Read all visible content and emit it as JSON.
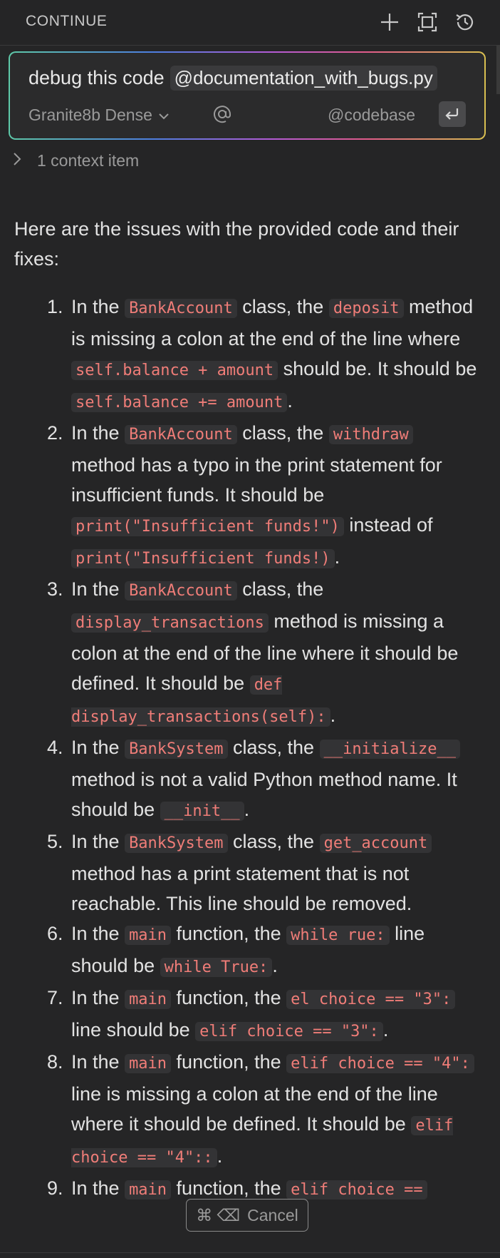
{
  "header": {
    "title": "CONTINUE"
  },
  "input": {
    "text": "debug this code",
    "mention": "@documentation_with_bugs.py",
    "model": "Granite8b Dense",
    "at_symbol": "@",
    "codebase": "@codebase"
  },
  "context": {
    "label": "1 context item"
  },
  "response": {
    "intro": "Here are the issues with the provided code and their fixes:",
    "items": [
      {
        "num": "1.",
        "parts": [
          {
            "t": "In the "
          },
          {
            "c": "BankAccount"
          },
          {
            "t": " class, the "
          },
          {
            "c": "deposit"
          },
          {
            "t": " method is missing a colon at the end of the line where "
          },
          {
            "c": "self.balance + amount"
          },
          {
            "t": " should be. It should be "
          },
          {
            "c": "self.balance += amount"
          },
          {
            "t": "."
          }
        ]
      },
      {
        "num": "2.",
        "parts": [
          {
            "t": "In the "
          },
          {
            "c": "BankAccount"
          },
          {
            "t": " class, the "
          },
          {
            "c": "withdraw"
          },
          {
            "t": " method has a typo in the print statement for insufficient funds. It should be "
          },
          {
            "c": "print(\"Insufficient funds!\")"
          },
          {
            "t": " instead of "
          },
          {
            "c": "print(\"Insufficient funds!)"
          },
          {
            "t": "."
          }
        ]
      },
      {
        "num": "3.",
        "parts": [
          {
            "t": "In the "
          },
          {
            "c": "BankAccount"
          },
          {
            "t": " class, the "
          },
          {
            "c": "display_transactions"
          },
          {
            "t": " method is missing a colon at the end of the line where it should be defined. It should be "
          },
          {
            "c": "def display_transactions(self):"
          },
          {
            "t": "."
          }
        ]
      },
      {
        "num": "4.",
        "parts": [
          {
            "t": "In the "
          },
          {
            "c": "BankSystem"
          },
          {
            "t": " class, the "
          },
          {
            "c": "__initialize__"
          },
          {
            "t": " method is not a valid Python method name. It should be "
          },
          {
            "c": "__init__"
          },
          {
            "t": "."
          }
        ]
      },
      {
        "num": "5.",
        "parts": [
          {
            "t": "In the "
          },
          {
            "c": "BankSystem"
          },
          {
            "t": " class, the "
          },
          {
            "c": "get_account"
          },
          {
            "t": " method has a print statement that is not reachable. This line should be removed."
          }
        ]
      },
      {
        "num": "6.",
        "parts": [
          {
            "t": "In the "
          },
          {
            "c": "main"
          },
          {
            "t": " function, the "
          },
          {
            "c": "while rue:"
          },
          {
            "t": " line should be "
          },
          {
            "c": "while True:"
          },
          {
            "t": "."
          }
        ]
      },
      {
        "num": "7.",
        "parts": [
          {
            "t": "In the "
          },
          {
            "c": "main"
          },
          {
            "t": " function, the "
          },
          {
            "c": "el choice == \"3\":"
          },
          {
            "t": " line should be "
          },
          {
            "c": "elif choice == \"3\":"
          },
          {
            "t": "."
          }
        ]
      },
      {
        "num": "8.",
        "parts": [
          {
            "t": "In the "
          },
          {
            "c": "main"
          },
          {
            "t": " function, the "
          },
          {
            "c": "elif choice == \"4\":"
          },
          {
            "t": " line is missing a colon at the end of the line where it should be defined. It should be "
          },
          {
            "c": "elif choice == \"4\"::"
          },
          {
            "t": "."
          }
        ]
      },
      {
        "num": "9.",
        "parts": [
          {
            "t": "In the "
          },
          {
            "c": "main"
          },
          {
            "t": " function, the "
          },
          {
            "c": "elif choice =="
          }
        ]
      }
    ]
  },
  "cancel": {
    "shortcut": "⌘ ⌫",
    "label": "Cancel"
  },
  "colors": {
    "code_text": "#f07d78",
    "code_bg": "#333335",
    "background": "#252526"
  },
  "icons": [
    "plus-icon",
    "fullscreen-icon",
    "history-icon",
    "chevron-down-icon",
    "at-icon",
    "enter-icon",
    "chevron-right-icon"
  ]
}
